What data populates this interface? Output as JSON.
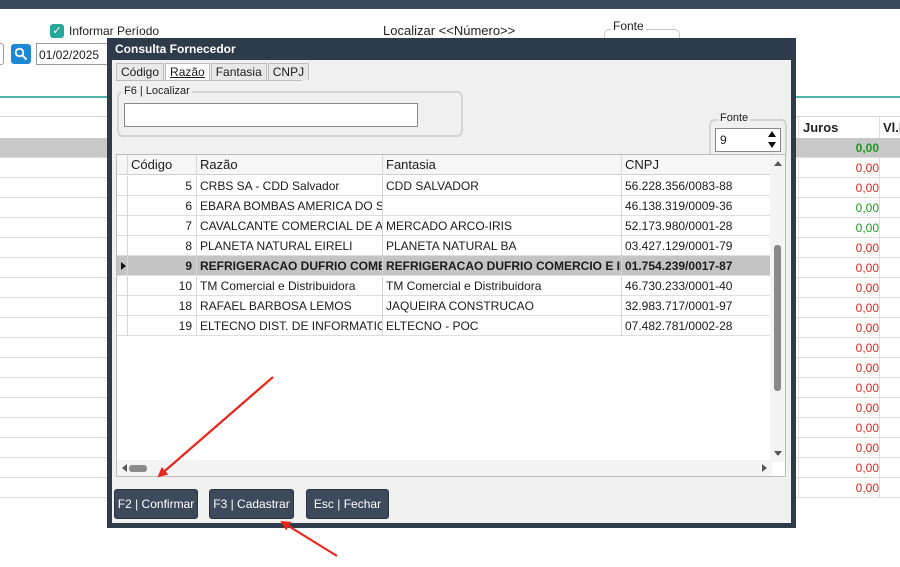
{
  "background": {
    "checkbox_label": "Informar Período",
    "date_value": "01/02/2025",
    "localizar_label": "Localizar <<Número>>",
    "fonte_label": "Fonte",
    "col_juros": "Juros",
    "col_vl": "Vl.I",
    "rows": [
      {
        "value": "0,00",
        "color": "bold-green"
      },
      {
        "value": "0,00",
        "color": "red"
      },
      {
        "value": "0,00",
        "color": "red"
      },
      {
        "value": "0,00",
        "color": "green"
      },
      {
        "value": "0,00",
        "color": "green"
      },
      {
        "value": "0,00",
        "color": "red"
      },
      {
        "value": "0,00",
        "color": "red"
      },
      {
        "value": "0,00",
        "color": "red"
      },
      {
        "value": "0,00",
        "color": "red"
      },
      {
        "value": "0,00",
        "color": "red"
      },
      {
        "value": "0,00",
        "color": "red"
      },
      {
        "value": "0,00",
        "color": "red"
      },
      {
        "value": "0,00",
        "color": "red"
      },
      {
        "value": "0,00",
        "color": "red"
      },
      {
        "value": "0,00",
        "color": "red"
      },
      {
        "value": "0,00",
        "color": "red"
      },
      {
        "value": "0,00",
        "color": "red"
      },
      {
        "value": "0,00",
        "color": "red"
      }
    ]
  },
  "dialog": {
    "title": "Consulta Fornecedor",
    "tabs": [
      "Código",
      "Razão",
      "Fantasia",
      "CNPJ"
    ],
    "active_tab": 1,
    "search_group_label": "F6 | Localizar",
    "search_value": "",
    "fonte_label": "Fonte",
    "fonte_value": "9",
    "columns": [
      "Código",
      "Razão",
      "Fantasia",
      "CNPJ"
    ],
    "rows": [
      {
        "codigo": "5",
        "razao": "CRBS SA - CDD Salvador",
        "fantasia": "CDD SALVADOR",
        "cnpj": "56.228.356/0083-88"
      },
      {
        "codigo": "6",
        "razao": "EBARA BOMBAS AMERICA DO SUL",
        "fantasia": "",
        "cnpj": "46.138.319/0009-36"
      },
      {
        "codigo": "7",
        "razao": "CAVALCANTE COMERCIAL DE ALI",
        "fantasia": "MERCADO ARCO-IRIS",
        "cnpj": "52.173.980/0001-28"
      },
      {
        "codigo": "8",
        "razao": "PLANETA NATURAL EIRELI",
        "fantasia": "PLANETA NATURAL BA",
        "cnpj": "03.427.129/0001-79"
      },
      {
        "codigo": "9",
        "razao": "REFRIGERACAO DUFRIO COMERC",
        "fantasia": "REFRIGERACAO DUFRIO COMERCIO E IMPO",
        "cnpj": "01.754.239/0017-87",
        "selected": true
      },
      {
        "codigo": "10",
        "razao": "TM Comercial e Distribuidora",
        "fantasia": "TM Comercial e Distribuidora",
        "cnpj": "46.730.233/0001-40"
      },
      {
        "codigo": "18",
        "razao": "RAFAEL BARBOSA LEMOS",
        "fantasia": "JAQUEIRA CONSTRUCAO",
        "cnpj": "32.983.717/0001-97"
      },
      {
        "codigo": "19",
        "razao": "ELTECNO DIST. DE INFORMATICA E",
        "fantasia": "ELTECNO - POC",
        "cnpj": "07.482.781/0002-28"
      }
    ],
    "buttons": {
      "confirm": "F2 | Confirmar",
      "register": "F3 | Cadastrar",
      "close": "Esc | Fechar"
    }
  },
  "annotation_color": "#e8261e"
}
